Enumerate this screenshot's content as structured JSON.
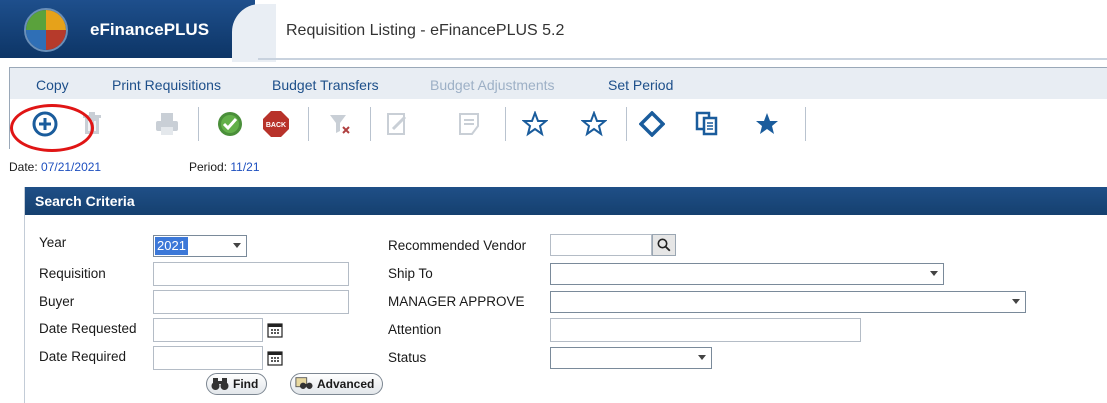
{
  "header": {
    "brand": "eFinancePLUS",
    "window_title": "Requisition Listing - eFinancePLUS 5.2"
  },
  "menu": {
    "items": [
      {
        "label": "Copy",
        "enabled": true
      },
      {
        "label": "Print Requisitions",
        "enabled": true
      },
      {
        "label": "Budget Transfers",
        "enabled": true
      },
      {
        "label": "Budget Adjustments",
        "enabled": false
      },
      {
        "label": "Set Period",
        "enabled": true
      }
    ]
  },
  "toolbar": {
    "icons": [
      "add-icon",
      "delete-icon",
      "print-icon",
      "ok-icon",
      "back-icon",
      "clear-filter-icon",
      "edit-icon",
      "note-icon",
      "star-outline-icon",
      "star-outline-icon",
      "diamond-icon",
      "copy-icon",
      "star-filled-icon"
    ],
    "accent": "#1a5c9c"
  },
  "status": {
    "date_label": "Date:",
    "date_value": "07/21/2021",
    "period_label": "Period:",
    "period_value": "11/21"
  },
  "search": {
    "title": "Search Criteria",
    "year_label": "Year",
    "year_value": "2021",
    "requisition_label": "Requisition",
    "buyer_label": "Buyer",
    "date_requested_label": "Date Requested",
    "date_required_label": "Date Required",
    "recommended_vendor_label": "Recommended Vendor",
    "ship_to_label": "Ship To",
    "manager_approve_label": "MANAGER APPROVE",
    "attention_label": "Attention",
    "status_label": "Status",
    "find_label": "Find",
    "advanced_label": "Advanced"
  }
}
